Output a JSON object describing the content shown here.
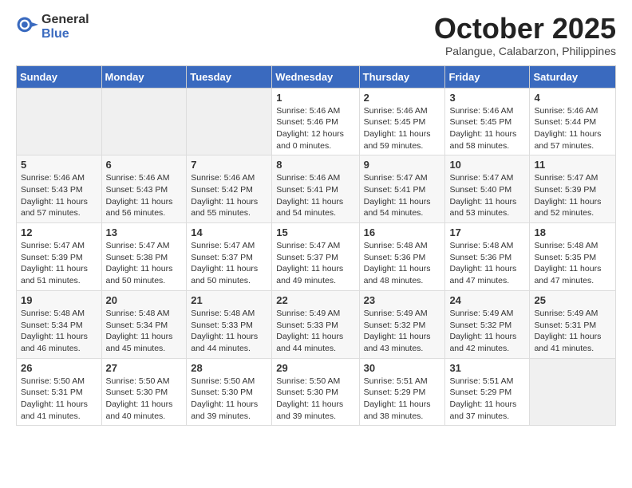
{
  "header": {
    "logo_general": "General",
    "logo_blue": "Blue",
    "month_title": "October 2025",
    "subtitle": "Palangue, Calabarzon, Philippines"
  },
  "weekdays": [
    "Sunday",
    "Monday",
    "Tuesday",
    "Wednesday",
    "Thursday",
    "Friday",
    "Saturday"
  ],
  "weeks": [
    [
      {
        "day": "",
        "info": ""
      },
      {
        "day": "",
        "info": ""
      },
      {
        "day": "",
        "info": ""
      },
      {
        "day": "1",
        "info": "Sunrise: 5:46 AM\nSunset: 5:46 PM\nDaylight: 12 hours\nand 0 minutes."
      },
      {
        "day": "2",
        "info": "Sunrise: 5:46 AM\nSunset: 5:45 PM\nDaylight: 11 hours\nand 59 minutes."
      },
      {
        "day": "3",
        "info": "Sunrise: 5:46 AM\nSunset: 5:45 PM\nDaylight: 11 hours\nand 58 minutes."
      },
      {
        "day": "4",
        "info": "Sunrise: 5:46 AM\nSunset: 5:44 PM\nDaylight: 11 hours\nand 57 minutes."
      }
    ],
    [
      {
        "day": "5",
        "info": "Sunrise: 5:46 AM\nSunset: 5:43 PM\nDaylight: 11 hours\nand 57 minutes."
      },
      {
        "day": "6",
        "info": "Sunrise: 5:46 AM\nSunset: 5:43 PM\nDaylight: 11 hours\nand 56 minutes."
      },
      {
        "day": "7",
        "info": "Sunrise: 5:46 AM\nSunset: 5:42 PM\nDaylight: 11 hours\nand 55 minutes."
      },
      {
        "day": "8",
        "info": "Sunrise: 5:46 AM\nSunset: 5:41 PM\nDaylight: 11 hours\nand 54 minutes."
      },
      {
        "day": "9",
        "info": "Sunrise: 5:47 AM\nSunset: 5:41 PM\nDaylight: 11 hours\nand 54 minutes."
      },
      {
        "day": "10",
        "info": "Sunrise: 5:47 AM\nSunset: 5:40 PM\nDaylight: 11 hours\nand 53 minutes."
      },
      {
        "day": "11",
        "info": "Sunrise: 5:47 AM\nSunset: 5:39 PM\nDaylight: 11 hours\nand 52 minutes."
      }
    ],
    [
      {
        "day": "12",
        "info": "Sunrise: 5:47 AM\nSunset: 5:39 PM\nDaylight: 11 hours\nand 51 minutes."
      },
      {
        "day": "13",
        "info": "Sunrise: 5:47 AM\nSunset: 5:38 PM\nDaylight: 11 hours\nand 50 minutes."
      },
      {
        "day": "14",
        "info": "Sunrise: 5:47 AM\nSunset: 5:37 PM\nDaylight: 11 hours\nand 50 minutes."
      },
      {
        "day": "15",
        "info": "Sunrise: 5:47 AM\nSunset: 5:37 PM\nDaylight: 11 hours\nand 49 minutes."
      },
      {
        "day": "16",
        "info": "Sunrise: 5:48 AM\nSunset: 5:36 PM\nDaylight: 11 hours\nand 48 minutes."
      },
      {
        "day": "17",
        "info": "Sunrise: 5:48 AM\nSunset: 5:36 PM\nDaylight: 11 hours\nand 47 minutes."
      },
      {
        "day": "18",
        "info": "Sunrise: 5:48 AM\nSunset: 5:35 PM\nDaylight: 11 hours\nand 47 minutes."
      }
    ],
    [
      {
        "day": "19",
        "info": "Sunrise: 5:48 AM\nSunset: 5:34 PM\nDaylight: 11 hours\nand 46 minutes."
      },
      {
        "day": "20",
        "info": "Sunrise: 5:48 AM\nSunset: 5:34 PM\nDaylight: 11 hours\nand 45 minutes."
      },
      {
        "day": "21",
        "info": "Sunrise: 5:48 AM\nSunset: 5:33 PM\nDaylight: 11 hours\nand 44 minutes."
      },
      {
        "day": "22",
        "info": "Sunrise: 5:49 AM\nSunset: 5:33 PM\nDaylight: 11 hours\nand 44 minutes."
      },
      {
        "day": "23",
        "info": "Sunrise: 5:49 AM\nSunset: 5:32 PM\nDaylight: 11 hours\nand 43 minutes."
      },
      {
        "day": "24",
        "info": "Sunrise: 5:49 AM\nSunset: 5:32 PM\nDaylight: 11 hours\nand 42 minutes."
      },
      {
        "day": "25",
        "info": "Sunrise: 5:49 AM\nSunset: 5:31 PM\nDaylight: 11 hours\nand 41 minutes."
      }
    ],
    [
      {
        "day": "26",
        "info": "Sunrise: 5:50 AM\nSunset: 5:31 PM\nDaylight: 11 hours\nand 41 minutes."
      },
      {
        "day": "27",
        "info": "Sunrise: 5:50 AM\nSunset: 5:30 PM\nDaylight: 11 hours\nand 40 minutes."
      },
      {
        "day": "28",
        "info": "Sunrise: 5:50 AM\nSunset: 5:30 PM\nDaylight: 11 hours\nand 39 minutes."
      },
      {
        "day": "29",
        "info": "Sunrise: 5:50 AM\nSunset: 5:30 PM\nDaylight: 11 hours\nand 39 minutes."
      },
      {
        "day": "30",
        "info": "Sunrise: 5:51 AM\nSunset: 5:29 PM\nDaylight: 11 hours\nand 38 minutes."
      },
      {
        "day": "31",
        "info": "Sunrise: 5:51 AM\nSunset: 5:29 PM\nDaylight: 11 hours\nand 37 minutes."
      },
      {
        "day": "",
        "info": ""
      }
    ]
  ]
}
